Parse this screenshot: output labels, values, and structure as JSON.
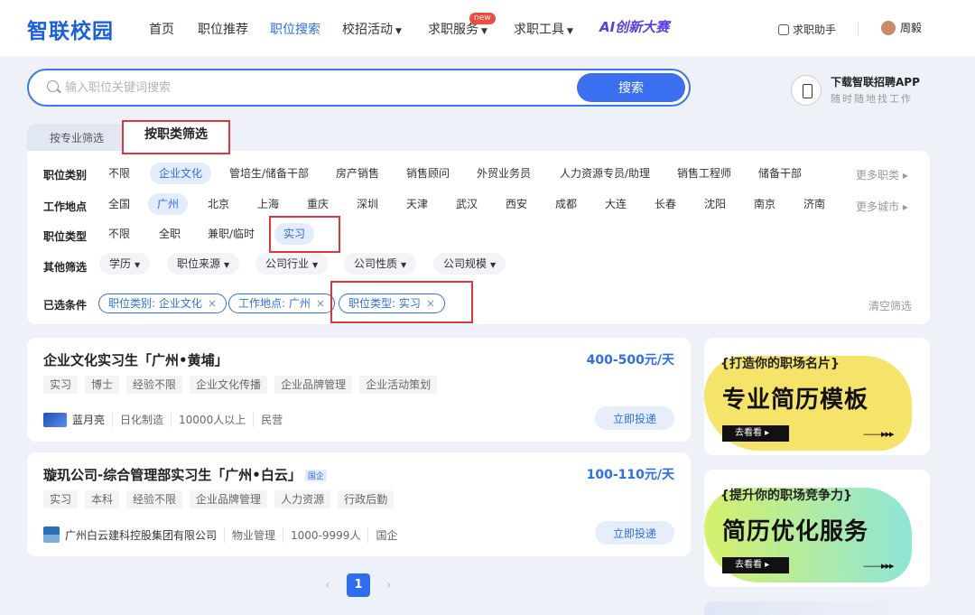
{
  "nav": {
    "logo": "智联校园",
    "items": [
      {
        "label": "首页",
        "caret": false
      },
      {
        "label": "职位推荐",
        "caret": false
      },
      {
        "label": "职位搜索",
        "caret": false,
        "active": true
      },
      {
        "label": "校招活动",
        "caret": true
      },
      {
        "label": "求职服务",
        "caret": true,
        "badge": "new"
      },
      {
        "label": "求职工具",
        "caret": true
      }
    ],
    "ai_brand": "AI创新大赛",
    "helper": "求职助手",
    "user": "周毅"
  },
  "search": {
    "placeholder": "输入职位关键词搜索",
    "value": "",
    "button": "搜索"
  },
  "app_download": {
    "title": "下载智联招聘APP",
    "subtitle": "随时随地找工作"
  },
  "filter_tabs": [
    "按专业筛选",
    "按职类筛选"
  ],
  "filters": {
    "category": {
      "label": "职位类别",
      "options": [
        "不限",
        "企业文化",
        "管培生/储备干部",
        "房产销售",
        "销售顾问",
        "外贸业务员",
        "人力资源专员/助理",
        "销售工程师",
        "储备干部"
      ],
      "selected": "企业文化",
      "more": "更多职类 ▸"
    },
    "location": {
      "label": "工作地点",
      "options": [
        "全国",
        "广州",
        "北京",
        "上海",
        "重庆",
        "深圳",
        "天津",
        "武汉",
        "西安",
        "成都",
        "大连",
        "长春",
        "沈阳",
        "南京",
        "济南"
      ],
      "selected": "广州",
      "more": "更多城市 ▸"
    },
    "type": {
      "label": "职位类型",
      "options": [
        "不限",
        "全职",
        "兼职/临时",
        "实习"
      ],
      "selected": "实习"
    },
    "other": {
      "label": "其他筛选",
      "dropdowns": [
        "学历",
        "职位来源",
        "公司行业",
        "公司性质",
        "公司规模"
      ]
    },
    "applied": {
      "label": "已选条件",
      "chips": [
        "职位类别: 企业文化",
        "工作地点: 广州",
        "职位类型: 实习"
      ],
      "clear": "清空筛选"
    }
  },
  "jobs": [
    {
      "title": "企业文化实习生「广州•黄埔」",
      "gov_tag": "",
      "salary": "400-500元/天",
      "tags": [
        "实习",
        "博士",
        "经验不限",
        "企业文化传播",
        "企业品牌管理",
        "企业活动策划"
      ],
      "company": "蓝月亮",
      "meta": [
        "日化制造",
        "10000人以上",
        "民营"
      ],
      "apply": "立即投递",
      "logo_color": "#1f4fb5"
    },
    {
      "title": "璇玑公司-综合管理部实习生「广州•白云」",
      "gov_tag": "国企",
      "salary": "100-110元/天",
      "tags": [
        "实习",
        "本科",
        "经验不限",
        "企业品牌管理",
        "人力资源",
        "行政后勤"
      ],
      "company": "广州白云建科控股集团有限公司",
      "meta": [
        "物业管理",
        "1000-9999人",
        "国企"
      ],
      "apply": "立即投递",
      "logo_color": "#2b6fb8"
    }
  ],
  "pagination": {
    "current": "1",
    "prev": "‹",
    "next": "›"
  },
  "banners": [
    {
      "sub": "{打造你的职场名片}",
      "main": "专业简历模板",
      "go": "去看看 ▸",
      "arrow": "——▸▸▸",
      "blob_color": "#f6e36a"
    },
    {
      "sub": "{提升你的职场竞争力}",
      "main": "简历优化服务",
      "go": "去看看 ▸",
      "arrow": "——▸▸▸",
      "blob_color": "#d6f06a"
    }
  ],
  "colors": {
    "accent": "#2d6ef0",
    "highlight_box": "#e0363b"
  }
}
